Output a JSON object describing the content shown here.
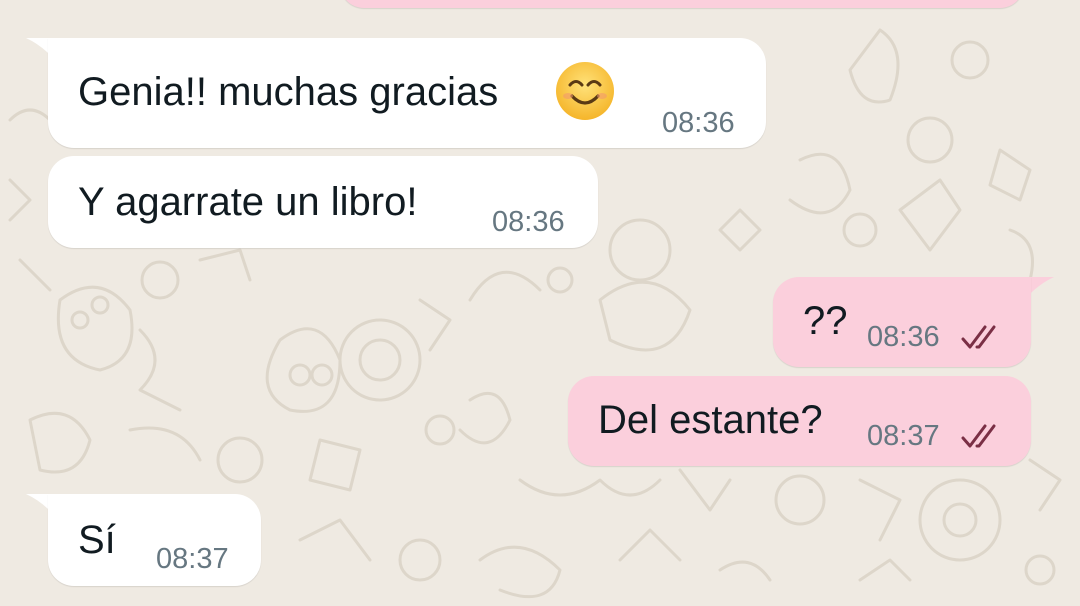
{
  "colors": {
    "wallpaper": "#efeae2",
    "incoming_bubble": "#ffffff",
    "outgoing_bubble": "#fbcfdc",
    "text": "#111b21",
    "time": "#667781",
    "read_ticks": "#7a2f45"
  },
  "messages": [
    {
      "direction": "incoming",
      "text": "Genia!! muchas gracias",
      "emoji": "smiling-face-with-smiling-eyes",
      "time": "08:36"
    },
    {
      "direction": "incoming",
      "text": "Y agarrate un libro!",
      "time": "08:36"
    },
    {
      "direction": "outgoing",
      "text": "??",
      "time": "08:36",
      "status": "read-double-check-icon"
    },
    {
      "direction": "outgoing",
      "text": "Del estante?",
      "time": "08:37",
      "status": "read-double-check-icon"
    },
    {
      "direction": "incoming",
      "text": "Sí",
      "time": "08:37"
    }
  ]
}
